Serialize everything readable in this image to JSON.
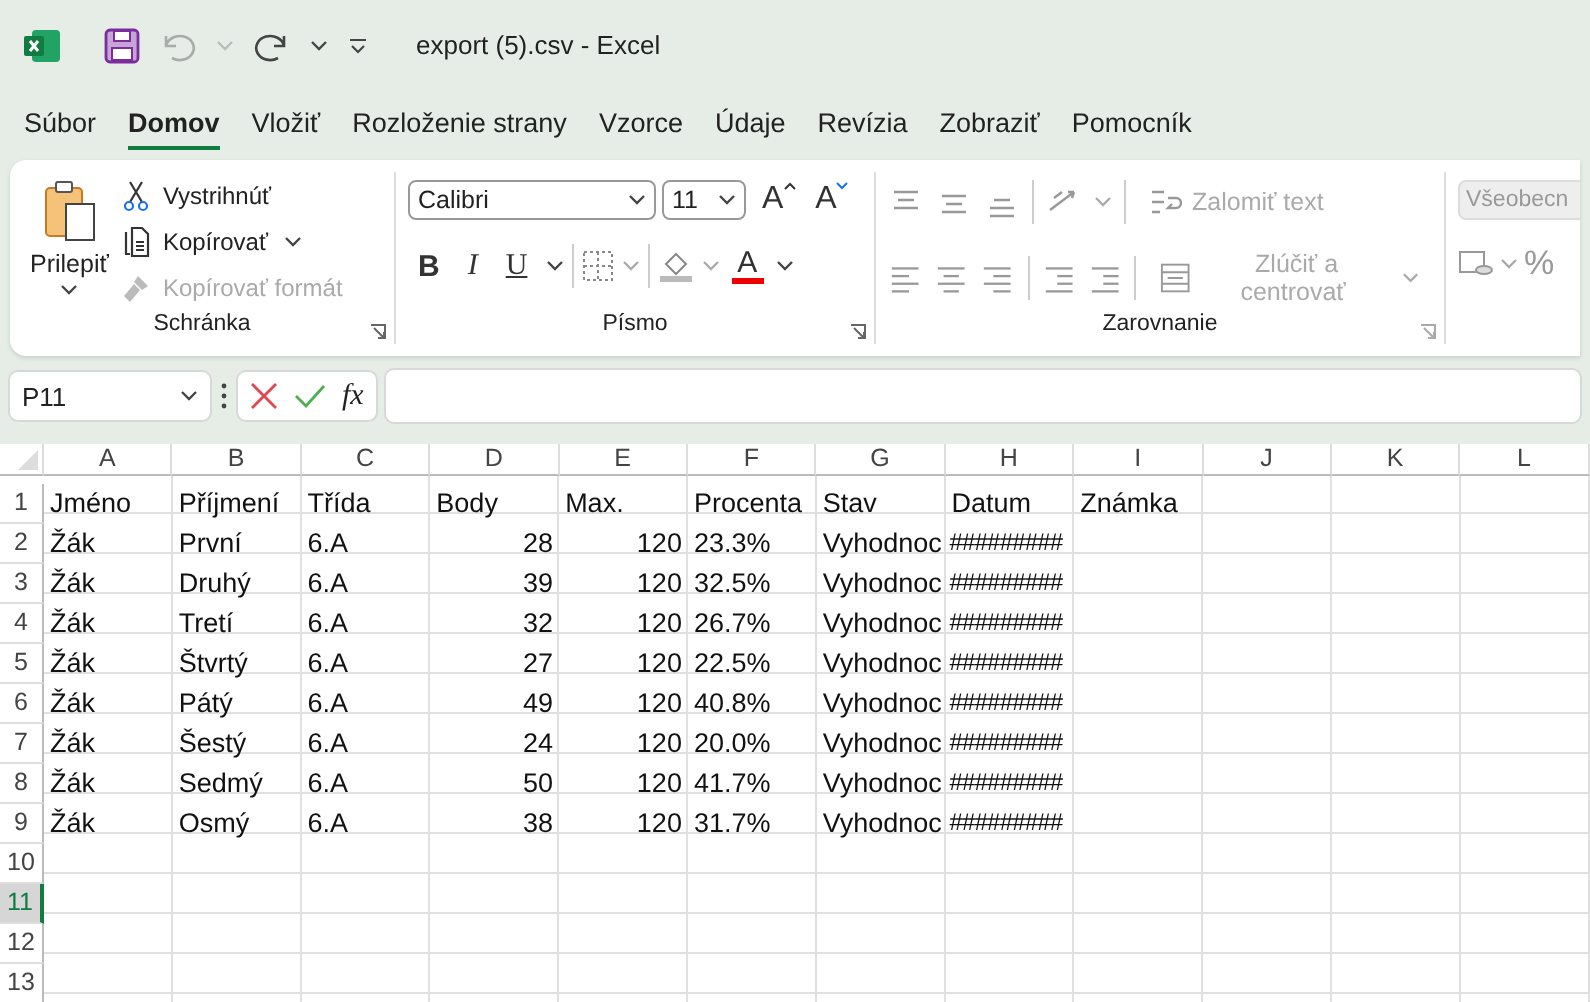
{
  "title_bar": {
    "title": "export (5).csv  -  Excel"
  },
  "menu_tabs": [
    {
      "label": "Súbor",
      "selected": false
    },
    {
      "label": "Domov",
      "selected": true
    },
    {
      "label": "Vložiť",
      "selected": false
    },
    {
      "label": "Rozloženie strany",
      "selected": false
    },
    {
      "label": "Vzorce",
      "selected": false
    },
    {
      "label": "Údaje",
      "selected": false
    },
    {
      "label": "Revízia",
      "selected": false
    },
    {
      "label": "Zobraziť",
      "selected": false
    },
    {
      "label": "Pomocník",
      "selected": false
    }
  ],
  "ribbon": {
    "clipboard": {
      "paste": "Prilepiť",
      "group_label": "Schránka",
      "items": [
        {
          "label": "Vystrihnúť",
          "kind": "cut",
          "disabled": false,
          "has_menu": false
        },
        {
          "label": "Kopírovať",
          "kind": "copy",
          "disabled": false,
          "has_menu": true
        },
        {
          "label": "Kopírovať formát",
          "kind": "painter",
          "disabled": true,
          "has_menu": false
        }
      ]
    },
    "font": {
      "name": "Calibri",
      "size": "11",
      "grow": "A",
      "shrink": "A",
      "group_label": "Písmo",
      "format_buttons": [
        {
          "label": "B",
          "kind": "bold"
        },
        {
          "label": "I",
          "kind": "italic"
        },
        {
          "label": "U",
          "kind": "underline"
        }
      ],
      "font_color": "A"
    },
    "alignment": {
      "group_label": "Zarovnanie",
      "wrap": {
        "label": "Zalomiť text",
        "disabled": true
      },
      "merge": {
        "label": "Zlúčiť a centrovať",
        "disabled": true
      }
    },
    "number": {
      "format": "Všeobecn",
      "disabled": true,
      "percent": "%"
    }
  },
  "formula_bar": {
    "name_box": "P11",
    "function_label": "fx"
  },
  "sheet": {
    "columns": [
      "A",
      "B",
      "C",
      "D",
      "E",
      "F",
      "G",
      "H",
      "I",
      "J",
      "K",
      "L"
    ],
    "rows": [
      {
        "number": "1",
        "selected": false,
        "cells": [
          {
            "text": "Jméno",
            "kind": "text"
          },
          {
            "text": "Příjmení",
            "kind": "text"
          },
          {
            "text": "Třída",
            "kind": "text"
          },
          {
            "text": "Body",
            "kind": "text"
          },
          {
            "text": "Max.",
            "kind": "text"
          },
          {
            "text": "Procenta",
            "kind": "text"
          },
          {
            "text": "Stav",
            "kind": "text"
          },
          {
            "text": "Datum",
            "kind": "text"
          },
          {
            "text": "Známka",
            "kind": "text"
          }
        ]
      },
      {
        "number": "2",
        "selected": false,
        "cells": [
          {
            "text": "Žák",
            "kind": "text"
          },
          {
            "text": "První",
            "kind": "text"
          },
          {
            "text": "6.A",
            "kind": "text"
          },
          {
            "text": "28",
            "kind": "number"
          },
          {
            "text": "120",
            "kind": "number"
          },
          {
            "text": "23.3%",
            "kind": "text"
          },
          {
            "text": "Vyhodnoc",
            "kind": "text"
          },
          {
            "text": "#########",
            "kind": "hashes"
          }
        ]
      },
      {
        "number": "3",
        "selected": false,
        "cells": [
          {
            "text": "Žák",
            "kind": "text"
          },
          {
            "text": "Druhý",
            "kind": "text"
          },
          {
            "text": "6.A",
            "kind": "text"
          },
          {
            "text": "39",
            "kind": "number"
          },
          {
            "text": "120",
            "kind": "number"
          },
          {
            "text": "32.5%",
            "kind": "text"
          },
          {
            "text": "Vyhodnoc",
            "kind": "text"
          },
          {
            "text": "#########",
            "kind": "hashes"
          }
        ]
      },
      {
        "number": "4",
        "selected": false,
        "cells": [
          {
            "text": "Žák",
            "kind": "text"
          },
          {
            "text": "Tretí",
            "kind": "text"
          },
          {
            "text": "6.A",
            "kind": "text"
          },
          {
            "text": "32",
            "kind": "number"
          },
          {
            "text": "120",
            "kind": "number"
          },
          {
            "text": "26.7%",
            "kind": "text"
          },
          {
            "text": "Vyhodnoc",
            "kind": "text"
          },
          {
            "text": "#########",
            "kind": "hashes"
          }
        ]
      },
      {
        "number": "5",
        "selected": false,
        "cells": [
          {
            "text": "Žák",
            "kind": "text"
          },
          {
            "text": "Štvrtý",
            "kind": "text"
          },
          {
            "text": "6.A",
            "kind": "text"
          },
          {
            "text": "27",
            "kind": "number"
          },
          {
            "text": "120",
            "kind": "number"
          },
          {
            "text": "22.5%",
            "kind": "text"
          },
          {
            "text": "Vyhodnoc",
            "kind": "text"
          },
          {
            "text": "#########",
            "kind": "hashes"
          }
        ]
      },
      {
        "number": "6",
        "selected": false,
        "cells": [
          {
            "text": "Žák",
            "kind": "text"
          },
          {
            "text": "Pátý",
            "kind": "text"
          },
          {
            "text": "6.A",
            "kind": "text"
          },
          {
            "text": "49",
            "kind": "number"
          },
          {
            "text": "120",
            "kind": "number"
          },
          {
            "text": "40.8%",
            "kind": "text"
          },
          {
            "text": "Vyhodnoc",
            "kind": "text"
          },
          {
            "text": "#########",
            "kind": "hashes"
          }
        ]
      },
      {
        "number": "7",
        "selected": false,
        "cells": [
          {
            "text": "Žák",
            "kind": "text"
          },
          {
            "text": "Šestý",
            "kind": "text"
          },
          {
            "text": "6.A",
            "kind": "text"
          },
          {
            "text": "24",
            "kind": "number"
          },
          {
            "text": "120",
            "kind": "number"
          },
          {
            "text": "20.0%",
            "kind": "text"
          },
          {
            "text": "Vyhodnoc",
            "kind": "text"
          },
          {
            "text": "#########",
            "kind": "hashes"
          }
        ]
      },
      {
        "number": "8",
        "selected": false,
        "cells": [
          {
            "text": "Žák",
            "kind": "text"
          },
          {
            "text": "Sedmý",
            "kind": "text"
          },
          {
            "text": "6.A",
            "kind": "text"
          },
          {
            "text": "50",
            "kind": "number"
          },
          {
            "text": "120",
            "kind": "number"
          },
          {
            "text": "41.7%",
            "kind": "text"
          },
          {
            "text": "Vyhodnoc",
            "kind": "text"
          },
          {
            "text": "#########",
            "kind": "hashes"
          }
        ]
      },
      {
        "number": "9",
        "selected": false,
        "cells": [
          {
            "text": "Žák",
            "kind": "text"
          },
          {
            "text": "Osmý",
            "kind": "text"
          },
          {
            "text": "6.A",
            "kind": "text"
          },
          {
            "text": "38",
            "kind": "number"
          },
          {
            "text": "120",
            "kind": "number"
          },
          {
            "text": "31.7%",
            "kind": "text"
          },
          {
            "text": "Vyhodnoc",
            "kind": "text"
          },
          {
            "text": "#########",
            "kind": "hashes"
          }
        ]
      },
      {
        "number": "10",
        "selected": false
      },
      {
        "number": "11",
        "selected": true
      },
      {
        "number": "12",
        "selected": false
      },
      {
        "number": "13",
        "selected": false
      }
    ]
  }
}
